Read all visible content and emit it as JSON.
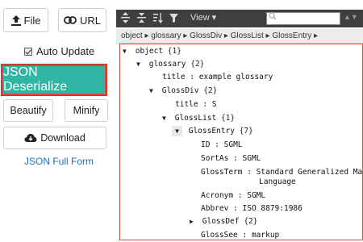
{
  "left": {
    "file_label": "File",
    "url_label": "URL",
    "auto_update_label": "Auto Update",
    "deserialize_label": "JSON Deserialize",
    "beautify_label": "Beautify",
    "minify_label": "Minify",
    "download_label": "Download",
    "full_form_label": "JSON Full Form",
    "accent_color": "#2fb6a4",
    "highlight_color": "#e0463d"
  },
  "toolbar": {
    "view_label": "View",
    "view_caret": "▾",
    "search_placeholder": "",
    "search_nav": "▲▼"
  },
  "breadcrumb": {
    "text": "object ▸ glossary ▸ GlossDiv ▸ GlossList ▸ GlossEntry ▸"
  },
  "tree": {
    "root": {
      "toggle": "▼",
      "key": "object",
      "count": "{1}"
    },
    "glossary": {
      "toggle": "▼",
      "key": "glossary",
      "count": "{2}"
    },
    "title1": {
      "key": "title",
      "sep": " : ",
      "value": "example glossary"
    },
    "glossdiv": {
      "toggle": "▼",
      "key": "GlossDiv",
      "count": "{2}"
    },
    "title2": {
      "key": "title",
      "sep": " : ",
      "value": "S"
    },
    "glosslist": {
      "toggle": "▼",
      "key": "GlossList",
      "count": "{1}"
    },
    "glossentry": {
      "toggle": "▼",
      "key": "GlossEntry",
      "count": "{7}"
    },
    "id": {
      "key": "ID",
      "sep": "  : ",
      "value": "SGML"
    },
    "sortas": {
      "key": "SortAs",
      "sep": " : ",
      "value": "SGML"
    },
    "glossterm": {
      "key": "GlossTerm",
      "sep": " : ",
      "value": "Standard Generalized Markup",
      "value2": "Language"
    },
    "acronym": {
      "key": "Acronym",
      "sep": " : ",
      "value": "SGML"
    },
    "abbrev": {
      "key": "Abbrev",
      "sep": " : ",
      "value": "ISO 8879:1986"
    },
    "glossdef": {
      "toggle": "▶",
      "key": "GlossDef",
      "count": "{2}"
    },
    "glosssee": {
      "key": "GlossSee",
      "sep": " : ",
      "value": "markup"
    }
  }
}
